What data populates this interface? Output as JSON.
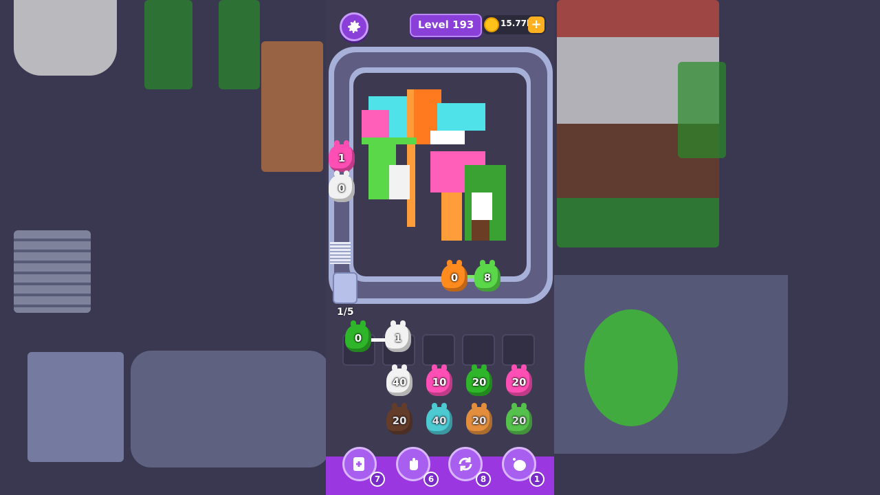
{
  "header": {
    "level_label": "Level 193",
    "coins": "15.77k",
    "coins_add": "+"
  },
  "conveyor": {
    "left_units": [
      {
        "color": "#ff4fb5",
        "count": "1"
      },
      {
        "color": "#f1f1f1",
        "count": "0"
      }
    ],
    "bottom_units": [
      {
        "color": "#ff8a1e",
        "count": "0"
      },
      {
        "color": "#5ad84a",
        "count": "8"
      }
    ],
    "counter": "1/5"
  },
  "slots": [
    {
      "color": "#2fb52a",
      "count": "0"
    },
    {
      "color": "#f2f2f2",
      "count": "1"
    },
    {
      "color": "",
      "count": ""
    },
    {
      "color": "",
      "count": ""
    },
    {
      "color": "",
      "count": ""
    }
  ],
  "queues": [
    {
      "front": {
        "color": "#f2f2f2",
        "count": "40"
      },
      "back": {
        "color": "#6b3d24",
        "count": "20"
      }
    },
    {
      "front": {
        "color": "#ff4fb5",
        "count": "10"
      },
      "back": {
        "color": "#4fe2e8",
        "count": "40"
      }
    },
    {
      "front": {
        "color": "#2fb52a",
        "count": "20"
      },
      "back": {
        "color": "#ff9d3a",
        "count": "20"
      }
    },
    {
      "front": {
        "color": "#ff4fb5",
        "count": "20"
      },
      "back": {
        "color": "#5ad84a",
        "count": "20"
      }
    }
  ],
  "boosters": [
    {
      "name": "add-slot",
      "count": "7"
    },
    {
      "name": "hand",
      "count": "6"
    },
    {
      "name": "shuffle",
      "count": "8"
    },
    {
      "name": "magic",
      "count": "1"
    }
  ],
  "colors": {
    "accent_purple": "#8a3fd8",
    "track": "#a7b0d8",
    "background": "#3d3a52"
  }
}
